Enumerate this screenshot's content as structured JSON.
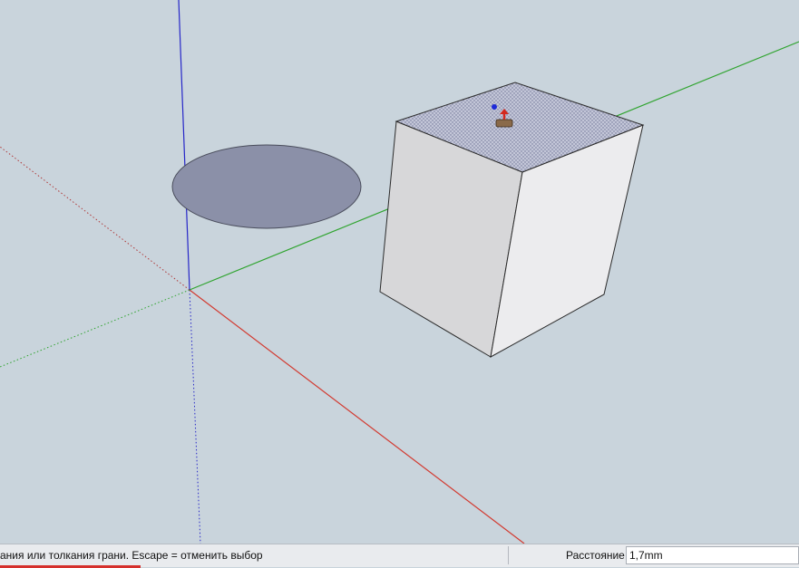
{
  "statusbar": {
    "message": "ания или толкания грани.  Escape = отменить выбор",
    "measurements_label": "Расстояние",
    "measurements_value": "1,7mm"
  },
  "colors": {
    "background": "#c9d4dc",
    "axis_red": "#d23a30",
    "axis_green": "#2fa42f",
    "axis_blue": "#2626c8",
    "circle_face": "#8b90a8",
    "box_face_light": "#ececee",
    "box_face_shade": "#d7d7d9",
    "selected_face": "#bfc2d6"
  },
  "tool_cursor": {
    "name": "push-pull-cursor-icon"
  }
}
